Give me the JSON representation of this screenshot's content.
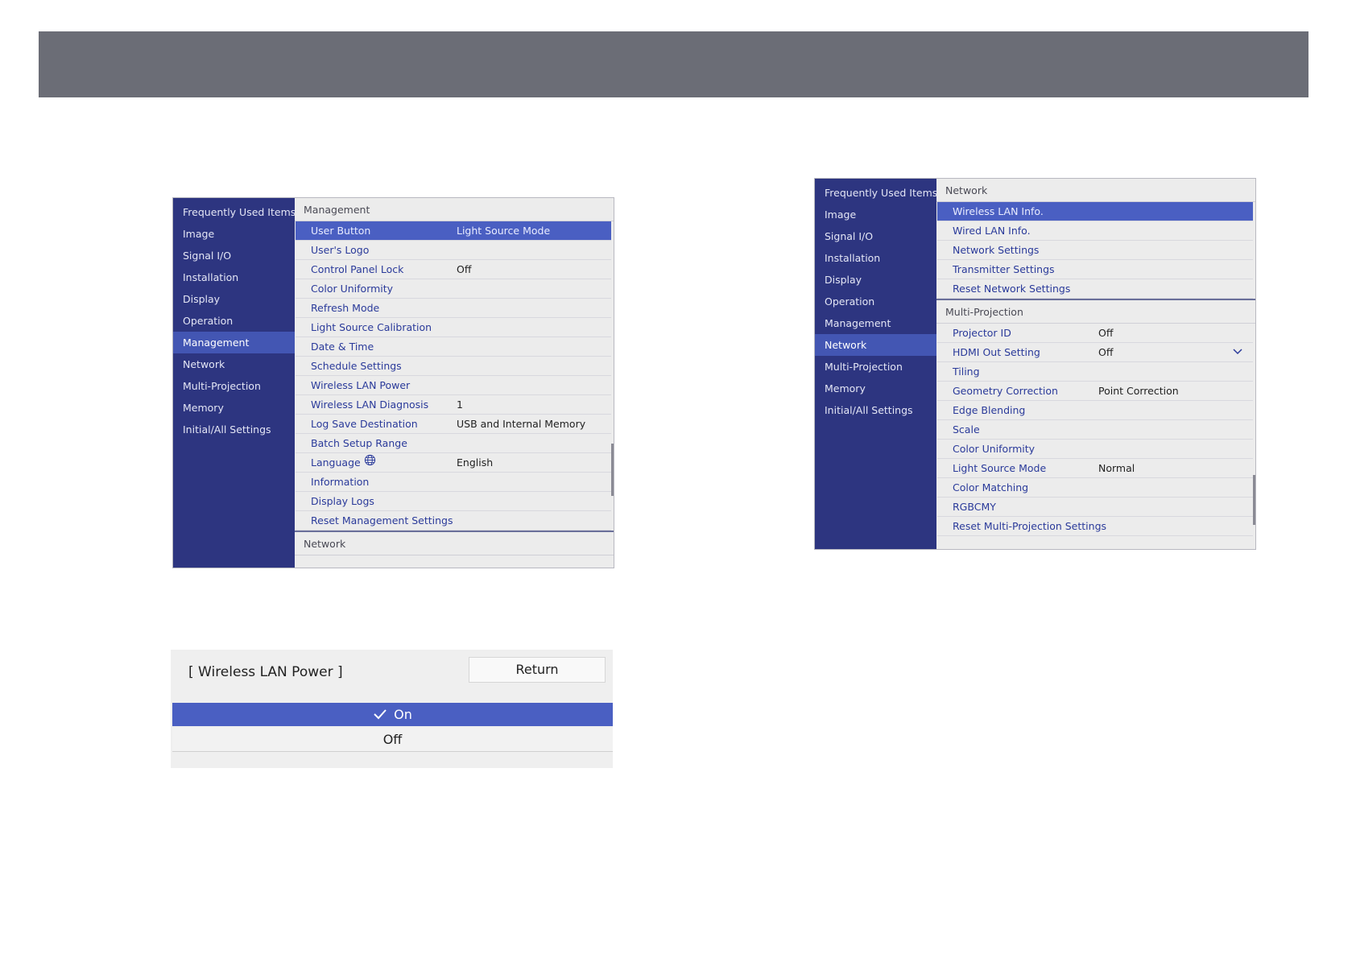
{
  "colors": {
    "banner": "#6b6d76",
    "sidebar": "#2d3580",
    "sidebar_active": "#4356b3",
    "selected_row": "#4a5fc2",
    "label_text": "#2a3a9a"
  },
  "menu1": {
    "sidebar": [
      "Frequently Used Items",
      "Image",
      "Signal I/O",
      "Installation",
      "Display",
      "Operation",
      "Management",
      "Network",
      "Multi-Projection",
      "Memory",
      "Initial/All Settings"
    ],
    "active_sidebar": "Management",
    "section_header": "Management",
    "rows": [
      {
        "label": "User Button",
        "value": "Light Source Mode"
      },
      {
        "label": "User's Logo",
        "value": ""
      },
      {
        "label": "Control Panel Lock",
        "value": "Off"
      },
      {
        "label": "Color Uniformity",
        "value": ""
      },
      {
        "label": "Refresh Mode",
        "value": ""
      },
      {
        "label": "Light Source Calibration",
        "value": ""
      },
      {
        "label": "Date & Time",
        "value": ""
      },
      {
        "label": "Schedule Settings",
        "value": ""
      },
      {
        "label": "Wireless LAN Power",
        "value": ""
      },
      {
        "label": "Wireless LAN Diagnosis",
        "value": "1"
      },
      {
        "label": "Log Save Destination",
        "value": "USB and Internal Memory"
      },
      {
        "label": "Batch Setup Range",
        "value": ""
      },
      {
        "label": "Language",
        "value": "English",
        "icon": "globe-icon"
      },
      {
        "label": "Information",
        "value": ""
      },
      {
        "label": "Display Logs",
        "value": ""
      },
      {
        "label": "Reset Management Settings",
        "value": ""
      }
    ],
    "next_section_header": "Network"
  },
  "menu2": {
    "sidebar": [
      "Frequently Used Items",
      "Image",
      "Signal I/O",
      "Installation",
      "Display",
      "Operation",
      "Management",
      "Network",
      "Multi-Projection",
      "Memory",
      "Initial/All Settings"
    ],
    "active_sidebar": "Network",
    "section_header": "Network",
    "rows": [
      {
        "label": "Wireless LAN Info.",
        "value": ""
      },
      {
        "label": "Wired LAN Info.",
        "value": ""
      },
      {
        "label": "Network Settings",
        "value": ""
      },
      {
        "label": "Transmitter Settings",
        "value": ""
      },
      {
        "label": "Reset Network Settings",
        "value": ""
      }
    ],
    "section2_header": "Multi-Projection",
    "rows2": [
      {
        "label": "Projector ID",
        "value": "Off"
      },
      {
        "label": "HDMI Out Setting",
        "value": "Off",
        "icon": "chevron-down-icon"
      },
      {
        "label": "Tiling",
        "value": ""
      },
      {
        "label": "Geometry Correction",
        "value": "Point Correction"
      },
      {
        "label": "Edge Blending",
        "value": ""
      },
      {
        "label": "Scale",
        "value": ""
      },
      {
        "label": "Color Uniformity",
        "value": ""
      },
      {
        "label": "Light Source Mode",
        "value": "Normal"
      },
      {
        "label": "Color Matching",
        "value": ""
      },
      {
        "label": "RGBCMY",
        "value": ""
      },
      {
        "label": "Reset Multi-Projection Settings",
        "value": ""
      }
    ]
  },
  "dialog": {
    "title": "[ Wireless LAN Power ]",
    "return_label": "Return",
    "options": [
      "On",
      "Off"
    ],
    "selected": "On"
  }
}
